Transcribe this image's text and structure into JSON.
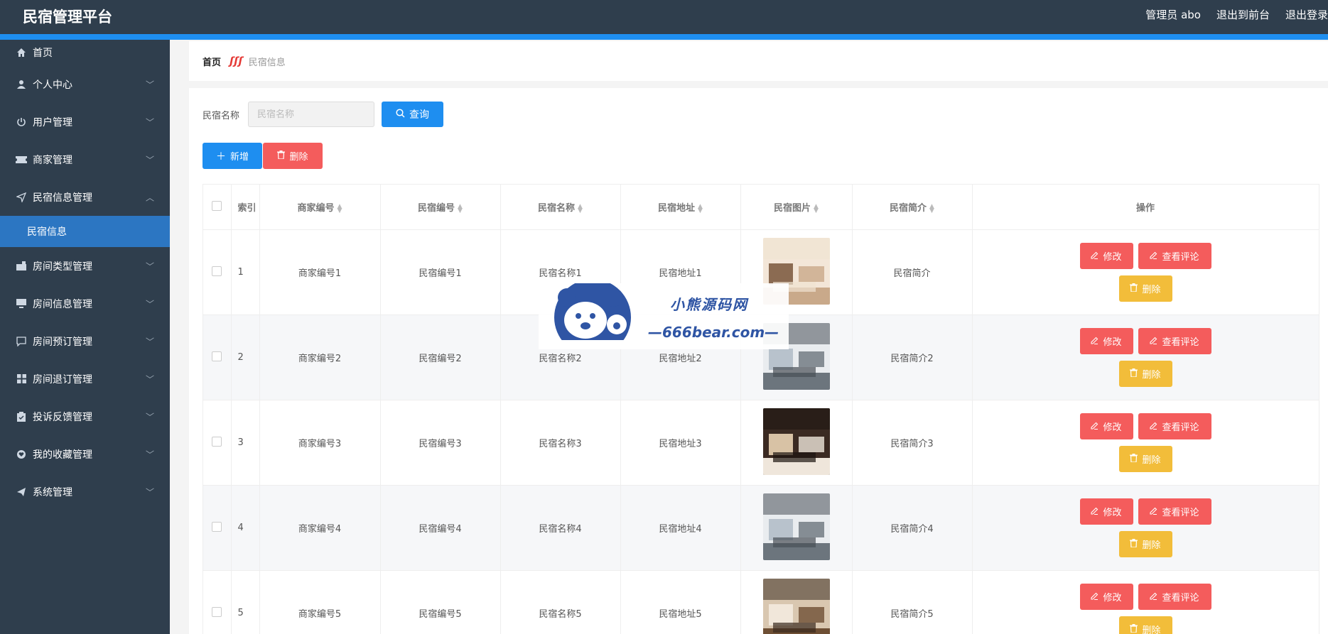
{
  "header": {
    "brand": "民宿管理平台",
    "admin_label": "管理员 abo",
    "to_front": "退出到前台",
    "logout": "退出登录"
  },
  "sidebar": {
    "items": [
      {
        "label": "首页",
        "icon": "home-icon"
      },
      {
        "label": "个人中心",
        "icon": "user-icon"
      },
      {
        "label": "用户管理",
        "icon": "power-icon"
      },
      {
        "label": "商家管理",
        "icon": "ticket-icon"
      },
      {
        "label": "民宿信息管理",
        "icon": "send-icon",
        "expanded": true
      },
      {
        "label": "房间类型管理",
        "icon": "suitcase-icon"
      },
      {
        "label": "房间信息管理",
        "icon": "monitor-icon"
      },
      {
        "label": "房间预订管理",
        "icon": "chat-icon"
      },
      {
        "label": "房间退订管理",
        "icon": "grid-icon"
      },
      {
        "label": "投诉反馈管理",
        "icon": "clipboard-icon"
      },
      {
        "label": "我的收藏管理",
        "icon": "heart-badge-icon"
      },
      {
        "label": "系统管理",
        "icon": "paper-plane-icon"
      }
    ],
    "active_sub": "民宿信息"
  },
  "breadcrumb": {
    "home": "首页",
    "separator": "ʃʃʃ",
    "current": "民宿信息"
  },
  "search": {
    "label": "民宿名称",
    "placeholder": "民宿名称",
    "value": "",
    "query_label": "查询"
  },
  "actions": {
    "add_label": "新增",
    "delete_label": "删除"
  },
  "table": {
    "columns": [
      "",
      "索引",
      "商家编号",
      "民宿编号",
      "民宿名称",
      "民宿地址",
      "民宿图片",
      "民宿简介",
      "操作"
    ],
    "rows": [
      {
        "index": "1",
        "merchant": "商家编号1",
        "homestay_no": "民宿编号1",
        "name": "民宿名称1",
        "address": "民宿地址1",
        "intro": "民宿简介"
      },
      {
        "index": "2",
        "merchant": "商家编号2",
        "homestay_no": "民宿编号2",
        "name": "民宿名称2",
        "address": "民宿地址2",
        "intro": "民宿简介2"
      },
      {
        "index": "3",
        "merchant": "商家编号3",
        "homestay_no": "民宿编号3",
        "name": "民宿名称3",
        "address": "民宿地址3",
        "intro": "民宿简介3"
      },
      {
        "index": "4",
        "merchant": "商家编号4",
        "homestay_no": "民宿编号4",
        "name": "民宿名称4",
        "address": "民宿地址4",
        "intro": "民宿简介4"
      },
      {
        "index": "5",
        "merchant": "商家编号5",
        "homestay_no": "民宿编号5",
        "name": "民宿名称5",
        "address": "民宿地址5",
        "intro": "民宿简介5"
      }
    ],
    "row_ops": {
      "edit": "修改",
      "review": "查看评论",
      "delete": "删除"
    }
  },
  "watermark": {
    "title": "小熊源码网",
    "subtitle": "—666bear.com—"
  },
  "colors": {
    "header_bg": "#2f3e4d",
    "accent_blue": "#1e8ef0",
    "danger": "#f45c5c",
    "warning": "#f2bd3a",
    "active_menu": "#2c76c2"
  }
}
